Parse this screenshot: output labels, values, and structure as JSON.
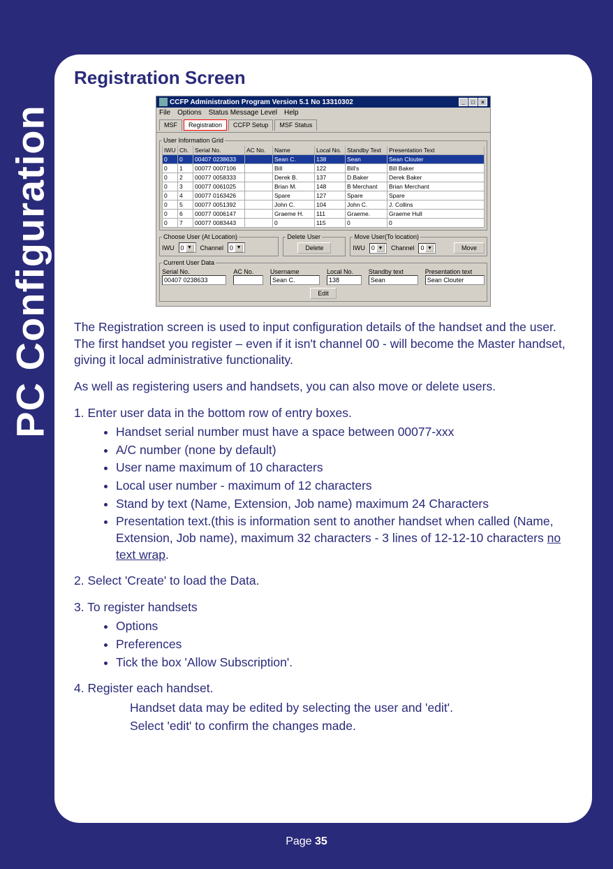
{
  "side_tab": "PC Configuration",
  "title": "Registration Screen",
  "screenshot": {
    "titlebar": "CCFP Administration Program Version 5.1 No 13310302",
    "menu": [
      "File",
      "Options",
      "Status Message Level",
      "Help"
    ],
    "tabs": [
      "MSF",
      "Registration",
      "CCFP Setup",
      "MSF Status"
    ],
    "grid_legend": "User Information Grid",
    "grid_headers": [
      "IWU",
      "Ch.",
      "Serial No.",
      "AC No.",
      "Name",
      "Local No.",
      "Standby Text",
      "Presentation Text"
    ],
    "grid_rows": [
      [
        "0",
        "0",
        "00407 0238633",
        "",
        "Sean C.",
        "138",
        "Sean",
        "Sean Clouter"
      ],
      [
        "0",
        "1",
        "00077 0007106",
        "",
        "Bill",
        "122",
        "Bill's",
        "Bill Baker"
      ],
      [
        "0",
        "2",
        "00077 0058333",
        "",
        "Derek B.",
        "137",
        "D.Baker",
        "Derek Baker"
      ],
      [
        "0",
        "3",
        "00077 0061025",
        "",
        "Brian M.",
        "148",
        "B Merchant",
        "Brian Merchant"
      ],
      [
        "0",
        "4",
        "00077 0163426",
        "",
        "Spare",
        "127",
        "Spare",
        "Spare"
      ],
      [
        "0",
        "5",
        "00077 0051392",
        "",
        "John C.",
        "104",
        "John C.",
        "J. Collins"
      ],
      [
        "0",
        "6",
        "00077 0006147",
        "",
        "Graeme H.",
        "111",
        "Graeme.",
        "Graeme Hull"
      ],
      [
        "0",
        "7",
        "00077 0083443",
        "",
        "0",
        "115",
        "0",
        "0"
      ]
    ],
    "choose_legend": "Choose User (At Location)",
    "choose_iwu_label": "IWU",
    "choose_iwu_val": "0",
    "choose_channel_label": "Channel",
    "choose_channel_val": "0",
    "delete_legend": "Delete User",
    "delete_btn": "Delete",
    "move_legend": "Move User(To location)",
    "move_iwu_label": "IWU",
    "move_iwu_val": "0",
    "move_channel_label": "Channel",
    "move_channel_val": "0",
    "move_btn": "Move",
    "current_legend": "Current User Data",
    "cur_labels": [
      "Serial No.",
      "AC No.",
      "Username",
      "Local No.",
      "Standby text",
      "Presentation text"
    ],
    "cur_vals": [
      "00407 0238633",
      "",
      "Sean C.",
      "138",
      "Sean",
      "Sean Clouter"
    ],
    "edit_btn": "Edit"
  },
  "para1": "The Registration screen is used to input configuration details of the handset and the user. The first handset you register – even if it isn't channel 00 - will become the Master handset, giving it local administrative functionality.",
  "para2": "As well as registering users and handsets, you can also move or delete users.",
  "step1": "1. Enter user data in the bottom row of entry boxes.",
  "step1_bullets": [
    "Handset serial number must have a space between 00077-xxx",
    "A/C number (none by default)",
    "User name maximum of 10 characters",
    "Local user number - maximum of 12 characters",
    "Stand by text (Name, Extension, Job name) maximum 24 Characters"
  ],
  "step1_bullet6a": "Presentation text.(this is information sent to another handset when called (Name, Extension, Job name), maximum 32 characters - 3 lines of 12-12-10 characters ",
  "step1_bullet6b": "no text wrap",
  "step1_bullet6c": ".",
  "step2": "2. Select 'Create' to load the Data.",
  "step3": "3. To register handsets",
  "step3_bullets": [
    "Options",
    "Preferences",
    "Tick the box 'Allow Subscription'."
  ],
  "step4": "4. Register each handset.",
  "step4_sub1": "Handset data may be edited by selecting the user and 'edit'.",
  "step4_sub2": "Select 'edit' to confirm the changes made.",
  "footer_prefix": "Page ",
  "footer_num": "35"
}
